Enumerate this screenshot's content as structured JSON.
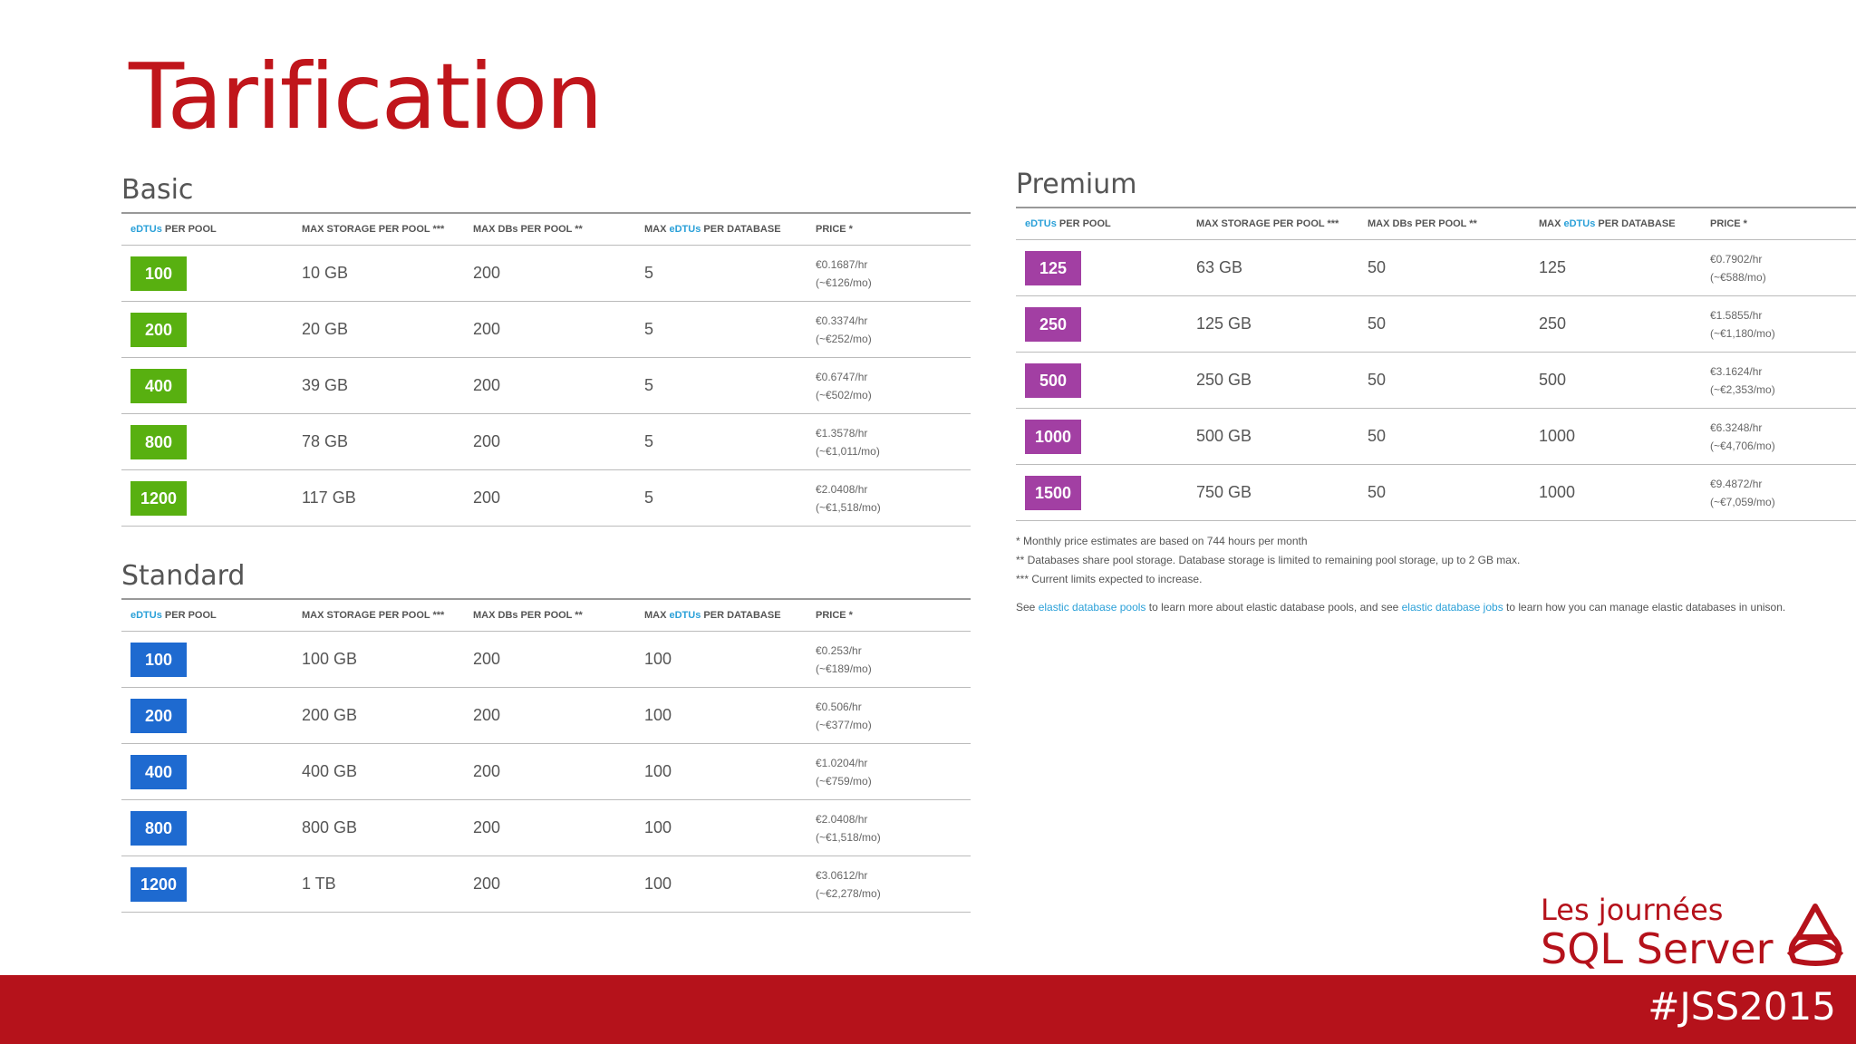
{
  "title": "Tarification",
  "headers": {
    "edtus": "eDTUs",
    "per_pool": " PER POOL",
    "max_storage": "MAX STORAGE PER POOL ***",
    "max_dbs": "MAX DBs PER POOL **",
    "max_prefix": "MAX ",
    "per_database": " PER DATABASE",
    "price": "PRICE *"
  },
  "basic": {
    "title": "Basic",
    "rows": [
      {
        "edtu": "100",
        "storage": "10 GB",
        "dbs": "200",
        "per_db": "5",
        "price_hr": "€0.1687/hr",
        "price_mo": "(~€126/mo)"
      },
      {
        "edtu": "200",
        "storage": "20 GB",
        "dbs": "200",
        "per_db": "5",
        "price_hr": "€0.3374/hr",
        "price_mo": "(~€252/mo)"
      },
      {
        "edtu": "400",
        "storage": "39 GB",
        "dbs": "200",
        "per_db": "5",
        "price_hr": "€0.6747/hr",
        "price_mo": "(~€502/mo)"
      },
      {
        "edtu": "800",
        "storage": "78 GB",
        "dbs": "200",
        "per_db": "5",
        "price_hr": "€1.3578/hr",
        "price_mo": "(~€1,011/mo)"
      },
      {
        "edtu": "1200",
        "storage": "117 GB",
        "dbs": "200",
        "per_db": "5",
        "price_hr": "€2.0408/hr",
        "price_mo": "(~€1,518/mo)"
      }
    ]
  },
  "standard": {
    "title": "Standard",
    "rows": [
      {
        "edtu": "100",
        "storage": "100 GB",
        "dbs": "200",
        "per_db": "100",
        "price_hr": "€0.253/hr",
        "price_mo": "(~€189/mo)"
      },
      {
        "edtu": "200",
        "storage": "200 GB",
        "dbs": "200",
        "per_db": "100",
        "price_hr": "€0.506/hr",
        "price_mo": "(~€377/mo)"
      },
      {
        "edtu": "400",
        "storage": "400 GB",
        "dbs": "200",
        "per_db": "100",
        "price_hr": "€1.0204/hr",
        "price_mo": "(~€759/mo)"
      },
      {
        "edtu": "800",
        "storage": "800 GB",
        "dbs": "200",
        "per_db": "100",
        "price_hr": "€2.0408/hr",
        "price_mo": "(~€1,518/mo)"
      },
      {
        "edtu": "1200",
        "storage": "1 TB",
        "dbs": "200",
        "per_db": "100",
        "price_hr": "€3.0612/hr",
        "price_mo": "(~€2,278/mo)"
      }
    ]
  },
  "premium": {
    "title": "Premium",
    "rows": [
      {
        "edtu": "125",
        "storage": "63 GB",
        "dbs": "50",
        "per_db": "125",
        "price_hr": "€0.7902/hr",
        "price_mo": "(~€588/mo)"
      },
      {
        "edtu": "250",
        "storage": "125 GB",
        "dbs": "50",
        "per_db": "250",
        "price_hr": "€1.5855/hr",
        "price_mo": "(~€1,180/mo)"
      },
      {
        "edtu": "500",
        "storage": "250 GB",
        "dbs": "50",
        "per_db": "500",
        "price_hr": "€3.1624/hr",
        "price_mo": "(~€2,353/mo)"
      },
      {
        "edtu": "1000",
        "storage": "500 GB",
        "dbs": "50",
        "per_db": "1000",
        "price_hr": "€6.3248/hr",
        "price_mo": "(~€4,706/mo)"
      },
      {
        "edtu": "1500",
        "storage": "750 GB",
        "dbs": "50",
        "per_db": "1000",
        "price_hr": "€9.4872/hr",
        "price_mo": "(~€7,059/mo)"
      }
    ]
  },
  "footnotes": {
    "note1": "* Monthly price estimates are based on 744 hours per month",
    "note2": "** Databases share pool storage. Database storage is limited to remaining pool storage, up to 2 GB max.",
    "note3": "*** Current limits expected to increase.",
    "see_prefix": "See ",
    "link1": "elastic database pools",
    "see_middle": " to learn more about elastic database pools, and see ",
    "link2": "elastic database jobs",
    "see_suffix": " to learn how you can manage elastic databases in unison."
  },
  "logo": {
    "line1": "Les journées",
    "line2": "SQL Server"
  },
  "hashtag": "#JSS2015",
  "colors": {
    "accent_red": "#b5121b",
    "basic": "#58b010",
    "standard": "#1e6ad0",
    "premium": "#a23fa3",
    "link": "#2aa0d8"
  }
}
